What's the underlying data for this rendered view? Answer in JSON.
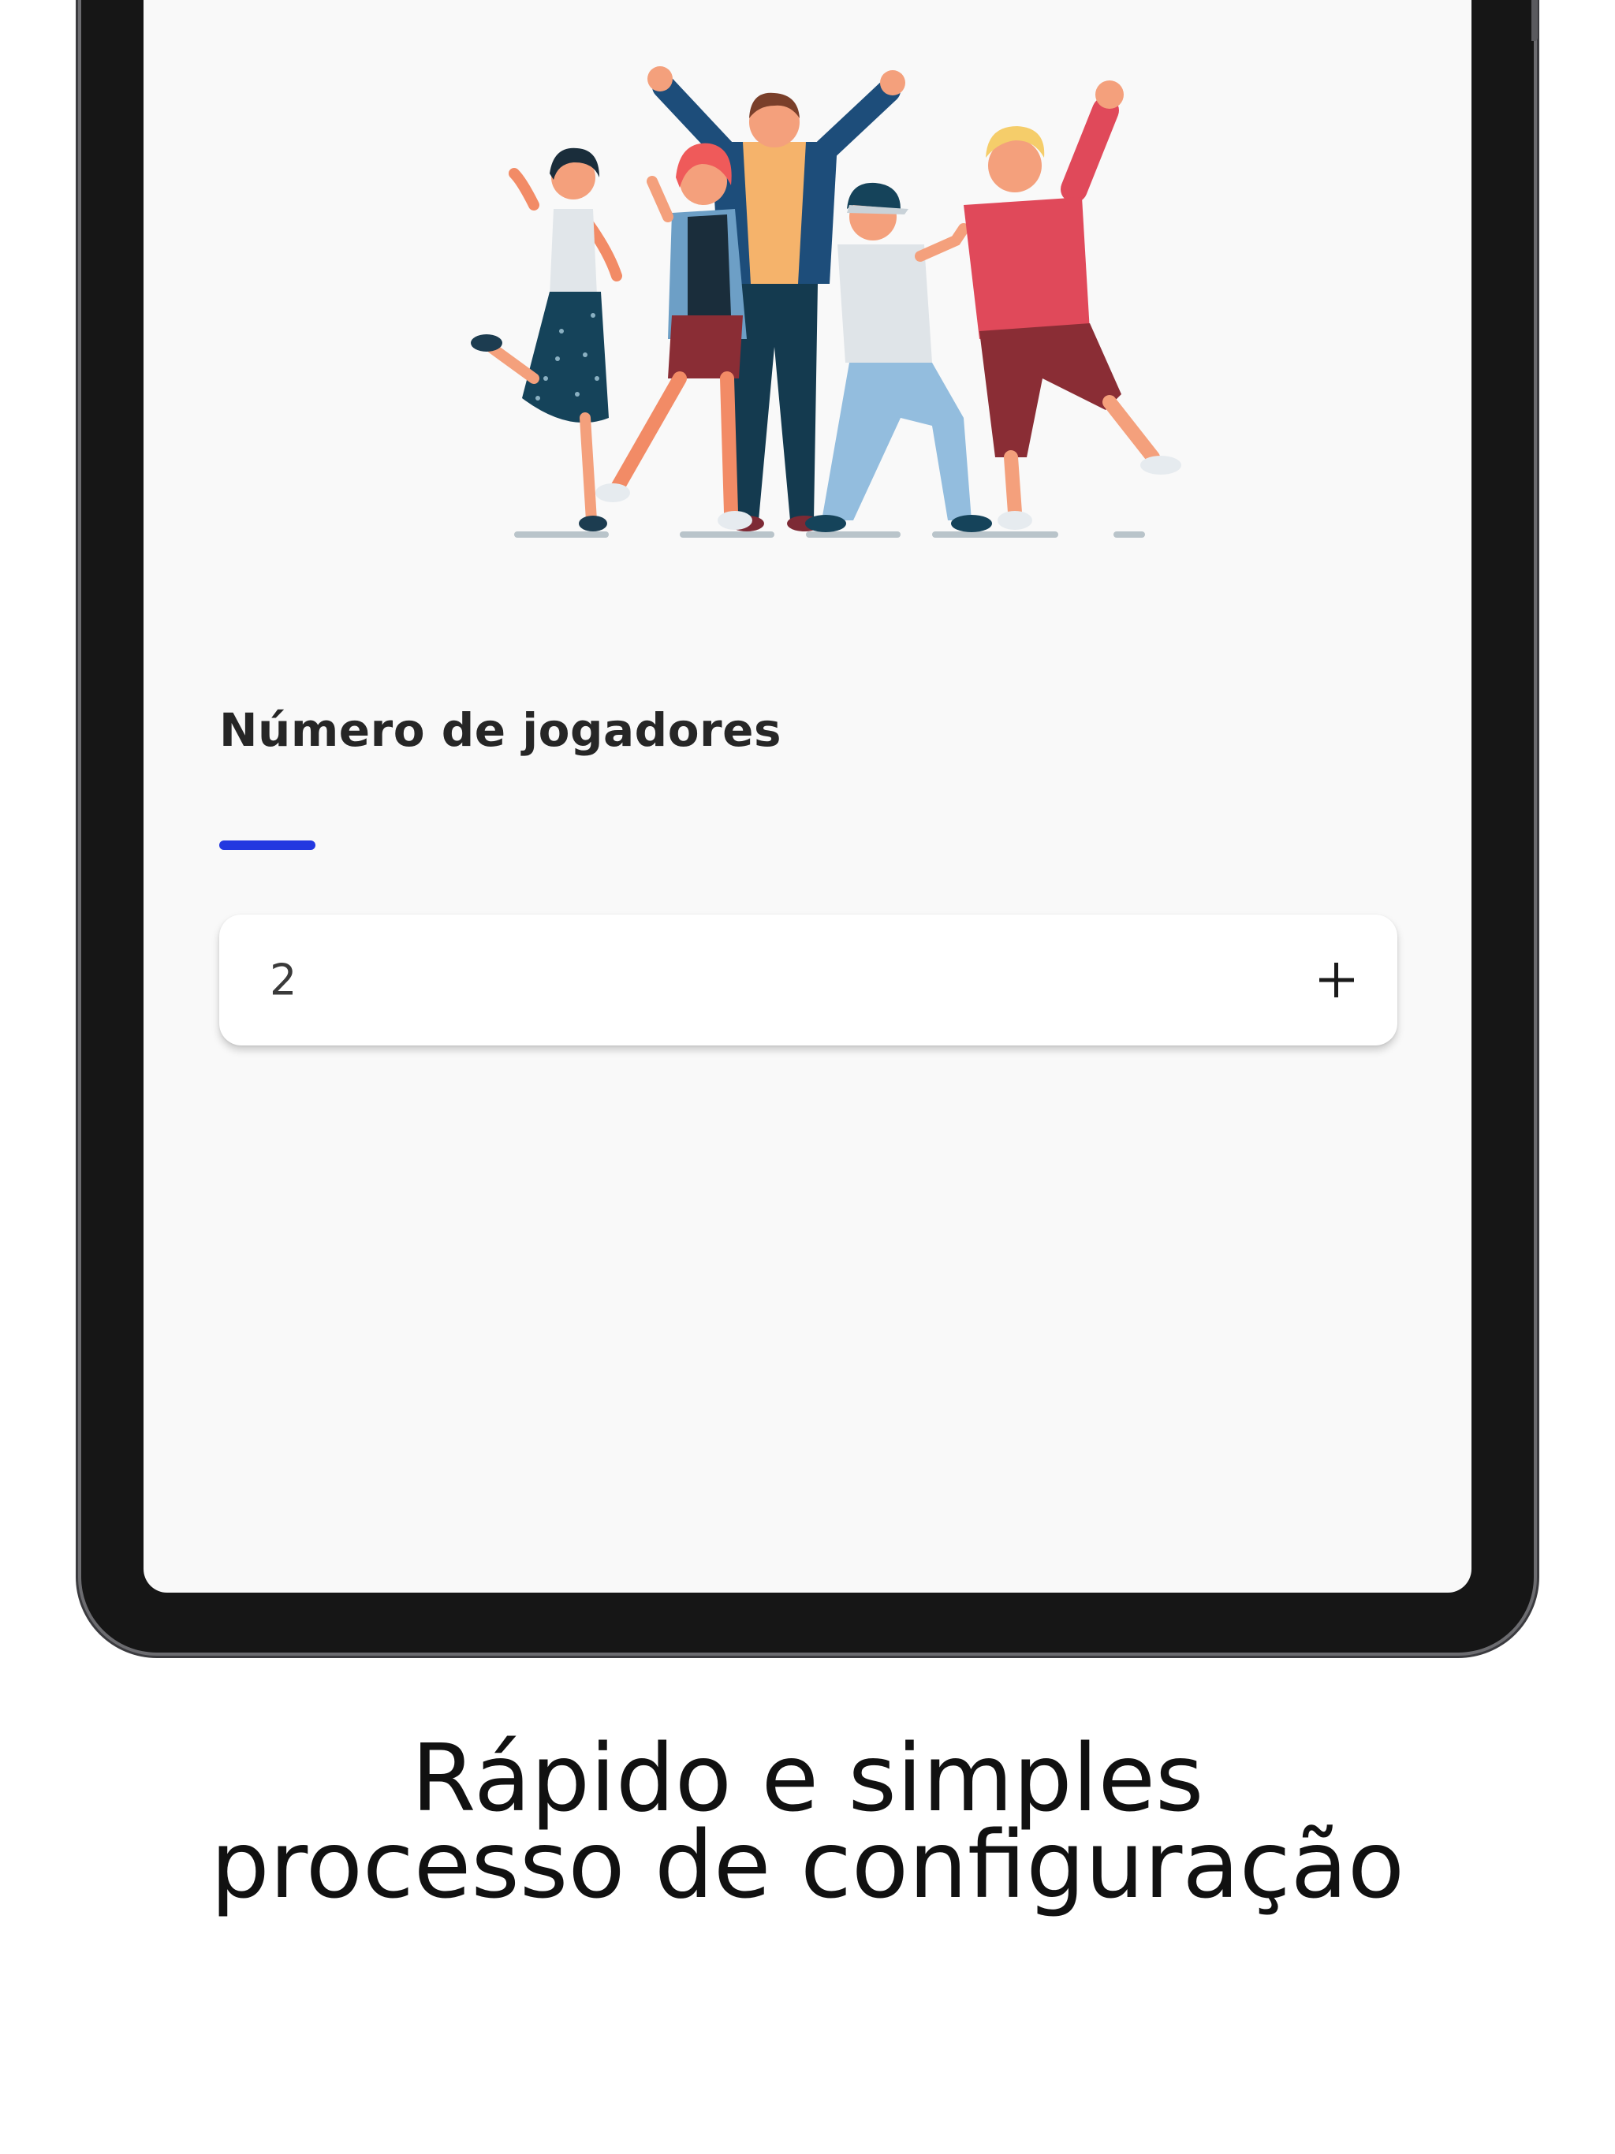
{
  "screen": {
    "section_title": "Número de jogadores",
    "accent_color": "#2338e0",
    "illustration": "group-of-friends-celebrating",
    "players_stepper": {
      "value": "2",
      "increment_icon": "plus-icon"
    }
  },
  "caption": {
    "line1": "Rápido e simples",
    "line2": "processo de configuração"
  }
}
